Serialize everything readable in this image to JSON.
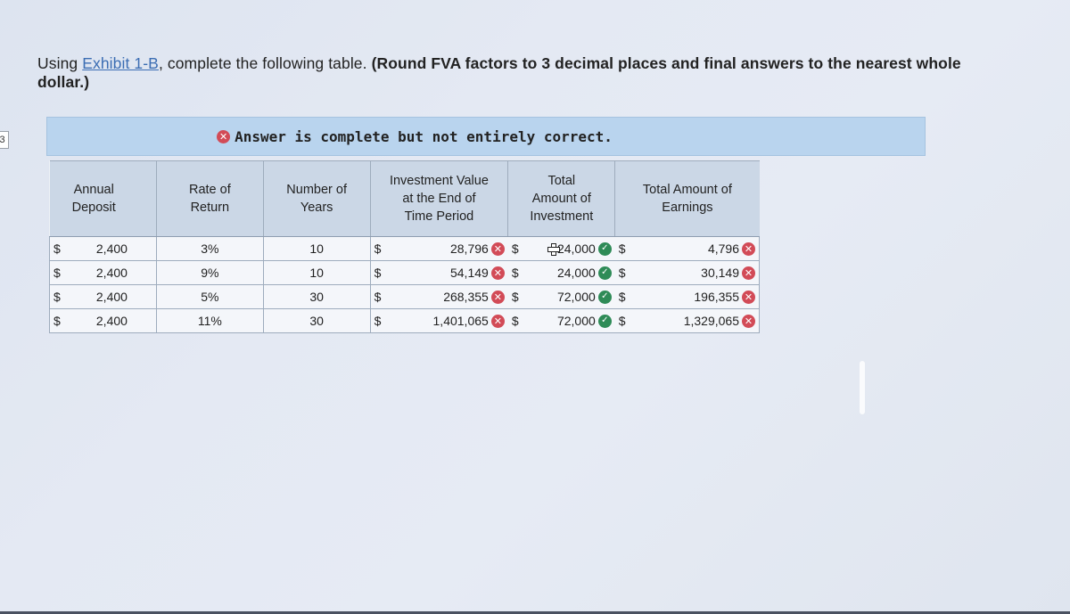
{
  "question_number": "3",
  "instruction": {
    "prefix": "Using ",
    "link": "Exhibit 1-B",
    "middle": ", complete the following table. ",
    "bold": "(Round FVA factors to 3 decimal places and final answers to the nearest whole dollar.)"
  },
  "banner": {
    "icon": "x-circle-icon",
    "text": "Answer is complete but not entirely correct."
  },
  "table": {
    "headers": {
      "annual_deposit": "Annual Deposit",
      "rate_of_return": "Rate of Return",
      "number_of_years": "Number of Years",
      "investment_value": "Investment Value at the End of Time Period",
      "total_investment": "Total Amount of Investment",
      "total_earnings": "Total Amount of Earnings"
    },
    "currency": "$",
    "rows": [
      {
        "deposit": "2,400",
        "rate": "3%",
        "years": "10",
        "investment_value": "28,796",
        "investment_value_status": "incorrect",
        "total_investment": "24,000",
        "total_investment_status": "correct",
        "total_earnings": "4,796",
        "total_earnings_status": "incorrect"
      },
      {
        "deposit": "2,400",
        "rate": "9%",
        "years": "10",
        "investment_value": "54,149",
        "investment_value_status": "incorrect",
        "total_investment": "24,000",
        "total_investment_status": "correct",
        "total_earnings": "30,149",
        "total_earnings_status": "incorrect"
      },
      {
        "deposit": "2,400",
        "rate": "5%",
        "years": "30",
        "investment_value": "268,355",
        "investment_value_status": "incorrect",
        "total_investment": "72,000",
        "total_investment_status": "correct",
        "total_earnings": "196,355",
        "total_earnings_status": "incorrect"
      },
      {
        "deposit": "2,400",
        "rate": "11%",
        "years": "30",
        "investment_value": "1,401,065",
        "investment_value_status": "incorrect",
        "total_investment": "72,000",
        "total_investment_status": "correct",
        "total_earnings": "1,329,065",
        "total_earnings_status": "incorrect"
      }
    ]
  },
  "colors": {
    "incorrect": "#d24b57",
    "correct": "#2e8b57",
    "banner_bg": "#b9d4ee",
    "link": "#3b6db3"
  }
}
